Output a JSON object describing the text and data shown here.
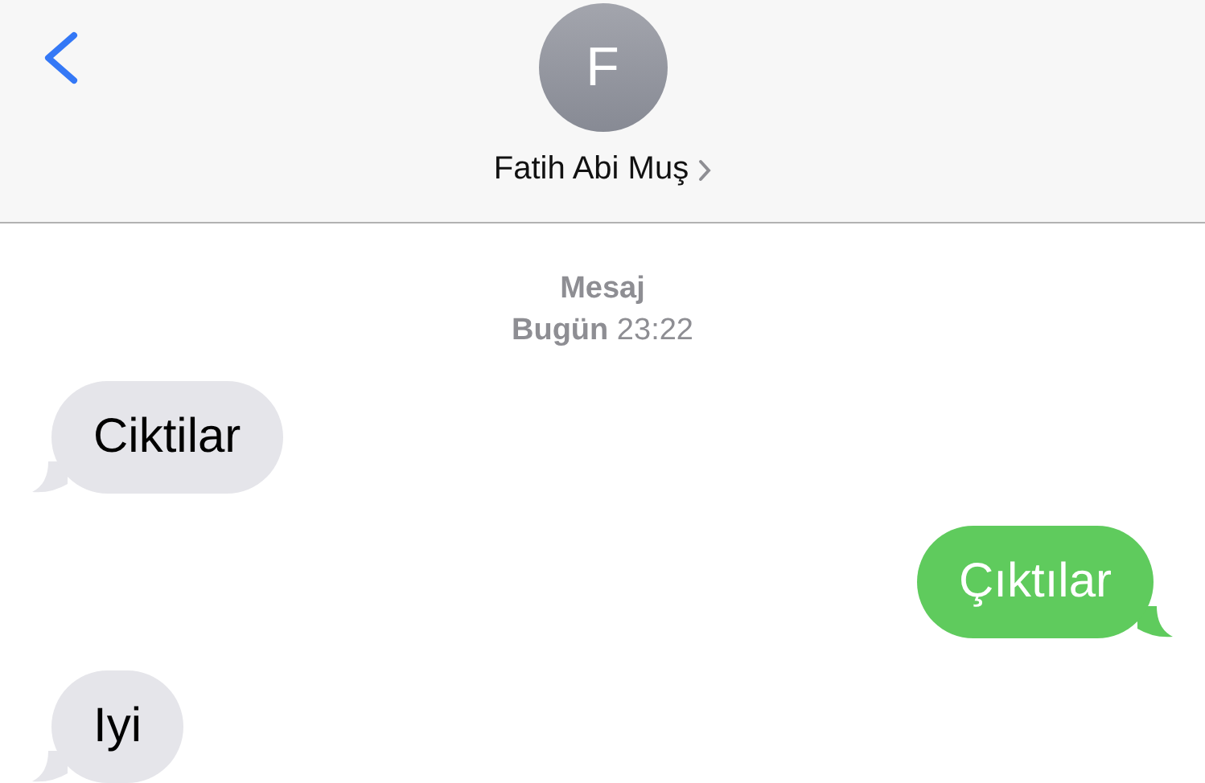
{
  "header": {
    "avatar_initial": "F",
    "contact_name": "Fatih Abi Muş"
  },
  "conversation": {
    "service_label": "Mesaj",
    "timestamp": "**Bugün** 23:22"
  },
  "messages": [
    {
      "kind": "received",
      "text": "Ciktilar"
    },
    {
      "kind": "sent",
      "text": "Çıktılar"
    },
    {
      "kind": "received",
      "text": "Iyi"
    }
  ]
}
